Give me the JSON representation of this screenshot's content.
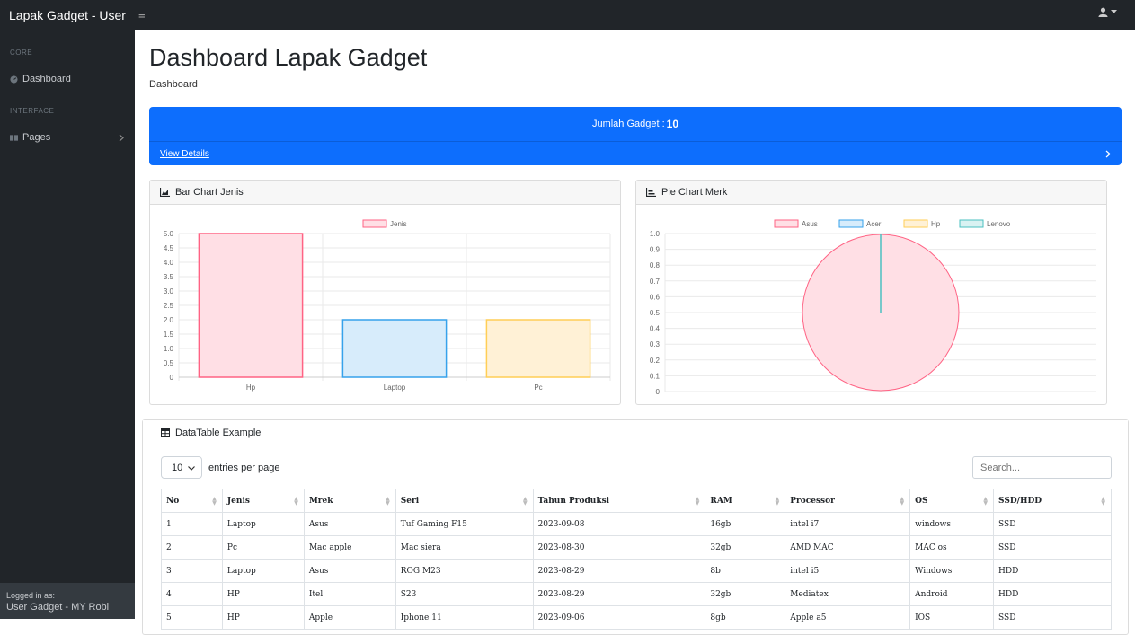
{
  "app": {
    "brand": "Lapak Gadget - User"
  },
  "sidebar": {
    "heading_core": "CORE",
    "dashboard": "Dashboard",
    "heading_interface": "INTERFACE",
    "pages": "Pages",
    "footer_small": "Logged in as:",
    "footer_name": "User Gadget - MY Robi"
  },
  "main": {
    "title": "Dashboard Lapak Gadget",
    "breadcrumb": "Dashboard"
  },
  "blue_card": {
    "label": "Jumlah Gadget :",
    "count": "10",
    "view_details": "View Details",
    "color": "#0d6efd"
  },
  "bar_card": {
    "title": "Bar Chart Jenis"
  },
  "pie_card": {
    "title": "Pie Chart Merk"
  },
  "chart_data": [
    {
      "type": "bar",
      "categories": [
        "Hp",
        "Laptop",
        "Pc"
      ],
      "series": [
        {
          "name": "Jenis",
          "values": [
            5,
            2,
            2
          ]
        }
      ],
      "colors": [
        "#ffdfe5",
        "#d7ecfb",
        "#fff1d6"
      ],
      "border_colors": [
        "#ff6384",
        "#36a2eb",
        "#ffce56"
      ],
      "ylim": [
        0,
        5
      ],
      "yticks": [
        "0",
        "0.5",
        "1.0",
        "1.5",
        "2.0",
        "2.5",
        "3.0",
        "3.5",
        "4.0",
        "4.5",
        "5.0"
      ],
      "legend": "top"
    },
    {
      "type": "pie",
      "labels": [
        "Asus",
        "Acer",
        "Hp",
        "Lenovo"
      ],
      "colors": [
        "#ffdfe5",
        "#d7ecfb",
        "#fff1d6",
        "#d9f2f2"
      ],
      "border_colors": [
        "#ff6384",
        "#36a2eb",
        "#ffce56",
        "#4bc0c0"
      ],
      "yticks": [
        "0",
        "0.1",
        "0.2",
        "0.3",
        "0.4",
        "0.5",
        "0.6",
        "0.7",
        "0.8",
        "0.9",
        "1.0"
      ],
      "legend": "top"
    }
  ],
  "table": {
    "title": "DataTable Example",
    "entries_value": "10",
    "entries_label": "entries per page",
    "search_placeholder": "Search...",
    "columns": [
      "No",
      "Jenis",
      "Mrek",
      "Seri",
      "Tahun Produksi",
      "RAM",
      "Processor",
      "OS",
      "SSD/HDD"
    ],
    "rows": [
      [
        "1",
        "Laptop",
        "Asus",
        "Tuf Gaming F15",
        "2023-09-08",
        "16gb",
        "intel i7",
        "windows",
        "SSD"
      ],
      [
        "2",
        "Pc",
        "Mac apple",
        "Mac siera",
        "2023-08-30",
        "32gb",
        "AMD MAC",
        "MAC os",
        "SSD"
      ],
      [
        "3",
        "Laptop",
        "Asus",
        "ROG M23",
        "2023-08-29",
        "8b",
        "intel i5",
        "Windows",
        "HDD"
      ],
      [
        "4",
        "HP",
        "Itel",
        "S23",
        "2023-08-29",
        "32gb",
        "Mediatex",
        "Android",
        "HDD"
      ],
      [
        "5",
        "HP",
        "Apple",
        "Iphone 11",
        "2023-09-06",
        "8gb",
        "Apple a5",
        "IOS",
        "SSD"
      ]
    ]
  }
}
